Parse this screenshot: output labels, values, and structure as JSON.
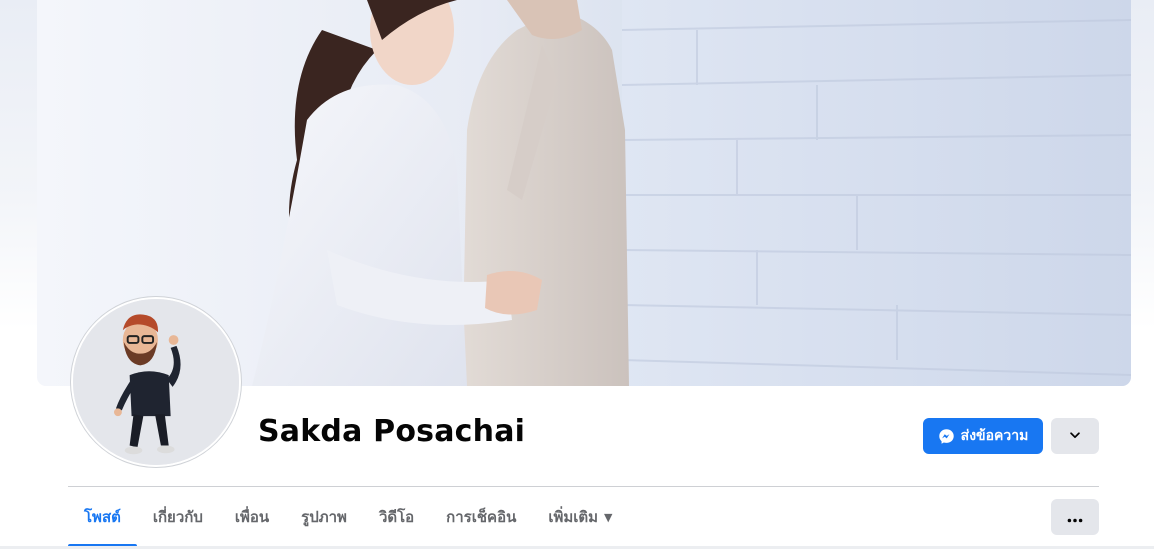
{
  "profile": {
    "name": "Sakda Posachai"
  },
  "actions": {
    "message_label": "ส่งข้อความ",
    "message_icon": "messenger-icon",
    "dropdown_icon": "chevron-down-icon",
    "more_icon": "ellipsis-icon"
  },
  "tabs": [
    {
      "label": "โพสต์",
      "active": true
    },
    {
      "label": "เกี่ยวกับ",
      "active": false
    },
    {
      "label": "เพื่อน",
      "active": false
    },
    {
      "label": "รูปภาพ",
      "active": false
    },
    {
      "label": "วิดีโอ",
      "active": false
    },
    {
      "label": "การเช็คอิน",
      "active": false
    },
    {
      "label": "เพิ่มเติม",
      "active": false,
      "has_caret": true
    }
  ],
  "colors": {
    "accent": "#1877f2",
    "secondary_button": "#e4e6eb",
    "text_primary": "#050505",
    "text_secondary": "#65676b"
  }
}
